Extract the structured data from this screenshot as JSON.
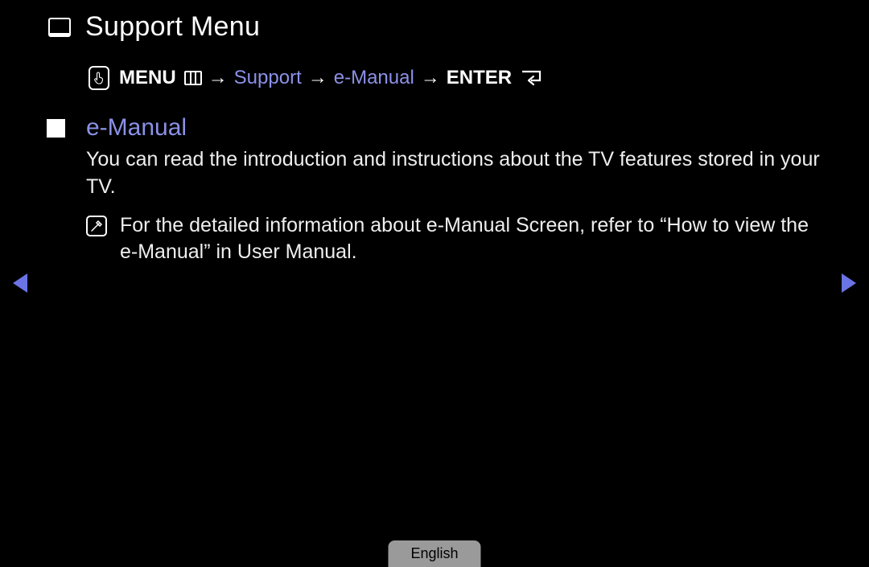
{
  "title": "Support Menu",
  "breadcrumb": {
    "menu": "MENU",
    "support": "Support",
    "emanual": "e-Manual",
    "enter": "ENTER",
    "arrow": "→"
  },
  "section": {
    "heading": "e-Manual",
    "body": "You can read the introduction and instructions about the TV features stored in your TV.",
    "note": "For the detailed information about e-Manual Screen, refer to “How to view the e-Manual” in User Manual."
  },
  "language": "English"
}
